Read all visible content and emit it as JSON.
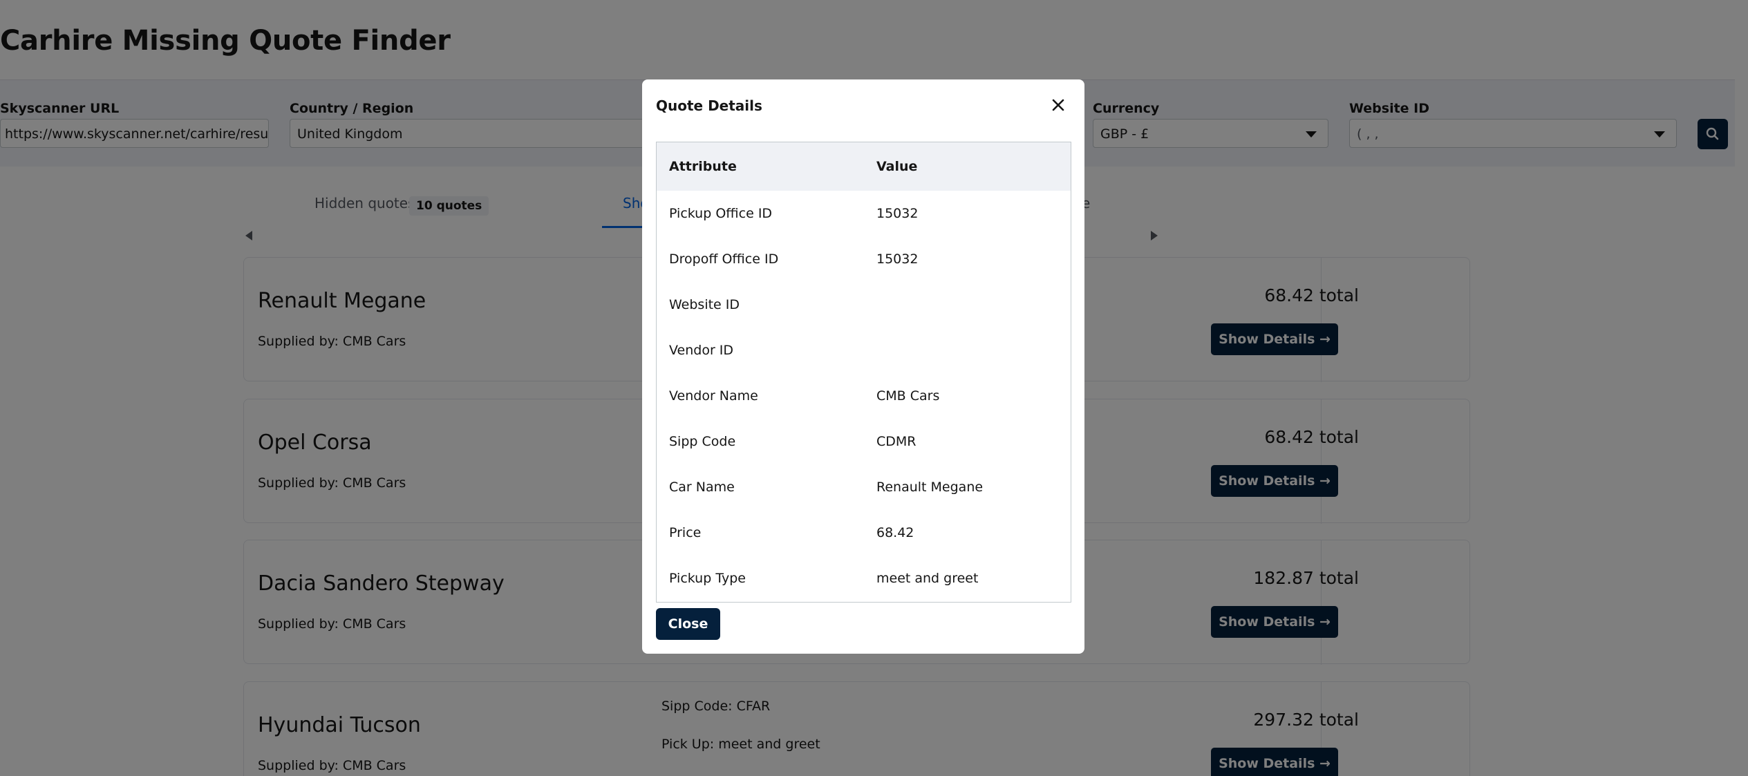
{
  "app": {
    "title": "Carhire Missing Quote Finder"
  },
  "form": {
    "url_label": "Skyscanner URL",
    "url_value": "https://www.skyscanner.net/carhire/resu",
    "country_label": "Country / Region",
    "country_value": "United Kingdom",
    "currency_label": "Currency",
    "currency_value": "GBP - £",
    "website_label": "Website ID",
    "website_value": "( ,  ,"
  },
  "tabs": {
    "hidden_label": "Hidden quotes",
    "hidden_count": "10 quotes",
    "shown_label": "Sho",
    "third_label": "e"
  },
  "cards": [
    {
      "name": "Renault Megane",
      "supplier": "Supplied by: CMB Cars",
      "total": "68.42 total",
      "button": "Show Details →"
    },
    {
      "name": "Opel Corsa",
      "supplier": "Supplied by: CMB Cars",
      "total": "68.42 total",
      "button": "Show Details →"
    },
    {
      "name": "Dacia Sandero Stepway",
      "supplier": "Supplied by: CMB Cars",
      "total": "182.87 total",
      "button": "Show Details →"
    },
    {
      "name": "Hyundai Tucson",
      "supplier": "Supplied by: CMB Cars",
      "total": "297.32 total",
      "button": "Show Details →",
      "sipp": "Sipp Code: CFAR",
      "pickup": "Pick Up: meet and greet"
    }
  ],
  "modal": {
    "title": "Quote Details",
    "header_attribute": "Attribute",
    "header_value": "Value",
    "rows": [
      {
        "attribute": "Pickup Office ID",
        "value": "15032"
      },
      {
        "attribute": "Dropoff Office ID",
        "value": "15032"
      },
      {
        "attribute": "Website ID",
        "value": ""
      },
      {
        "attribute": "Vendor ID",
        "value": ""
      },
      {
        "attribute": "Vendor Name",
        "value": "CMB Cars"
      },
      {
        "attribute": "Sipp Code",
        "value": "CDMR"
      },
      {
        "attribute": "Car Name",
        "value": "Renault Megane"
      },
      {
        "attribute": "Price",
        "value": "68.42"
      },
      {
        "attribute": "Pickup Type",
        "value": "meet and greet"
      }
    ],
    "close_label": "Close"
  },
  "colors": {
    "primary": "#05203c",
    "accent": "#0062e3",
    "form_bg": "#f1f2f8"
  }
}
